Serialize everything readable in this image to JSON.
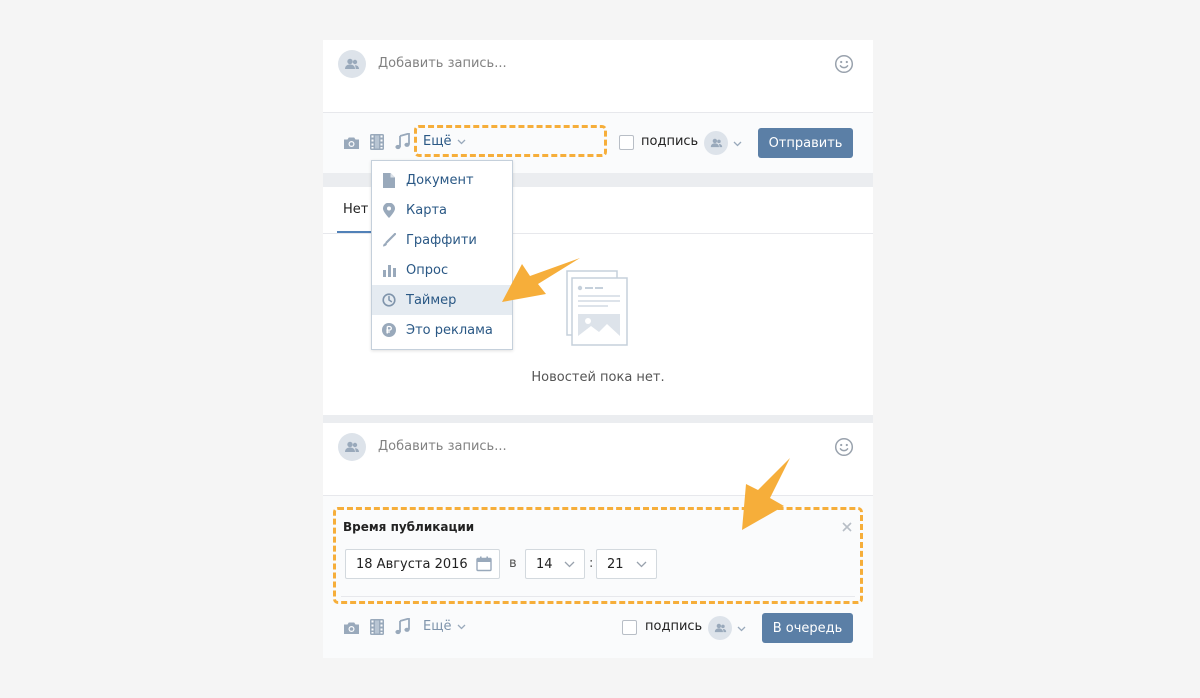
{
  "composer_top": {
    "placeholder": "Добавить запись...",
    "more_label": "Ещё",
    "signature_label": "подпись",
    "send_label": "Отправить"
  },
  "more_menu": {
    "items": [
      {
        "label": "Документ",
        "icon": "document-icon"
      },
      {
        "label": "Карта",
        "icon": "map-pin-icon"
      },
      {
        "label": "Граффити",
        "icon": "brush-icon"
      },
      {
        "label": "Опрос",
        "icon": "poll-icon"
      },
      {
        "label": "Таймер",
        "icon": "clock-icon",
        "active": true
      },
      {
        "label": "Это реклама",
        "icon": "ruble-icon"
      }
    ]
  },
  "feed": {
    "tab_label": "Нет з",
    "empty_text": "Новостей пока нет."
  },
  "composer_bottom": {
    "placeholder": "Добавить запись...",
    "publish_time_title": "Время публикации",
    "date_value": "18 Августа 2016",
    "at_label": "в",
    "hour_value": "14",
    "colon": ":",
    "minute_value": "21",
    "more_label": "Ещё",
    "signature_label": "подпись",
    "queue_label": "В очередь"
  },
  "colors": {
    "accent": "#5b7fa6",
    "highlight": "#f6ae3a",
    "link": "#2a5885"
  }
}
